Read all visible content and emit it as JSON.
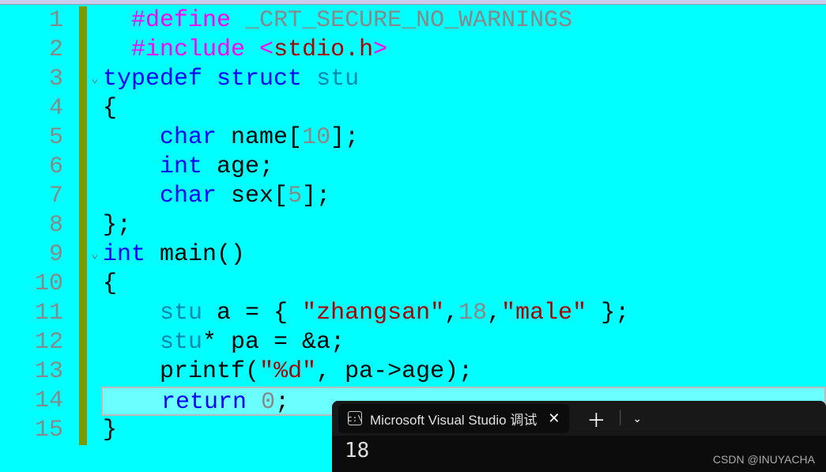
{
  "gutter": [
    "1",
    "2",
    "3",
    "4",
    "5",
    "6",
    "7",
    "8",
    "9",
    "10",
    "11",
    "12",
    "13",
    "14",
    "15"
  ],
  "code": {
    "l1": {
      "pp": "#define",
      "sp": " ",
      "macro": "_CRT_SECURE_NO_WARNINGS"
    },
    "l2": {
      "pp": "#include ",
      "open": "<",
      "hdr": "stdio.h",
      "close": ">"
    },
    "l3": {
      "kw1": "typedef",
      "sp": " ",
      "kw2": "struct",
      "sp2": " ",
      "name": "stu"
    },
    "l4": {
      "brace": "{"
    },
    "l5": {
      "indent": "    ",
      "type": "char",
      "sp": " ",
      "ident": "name",
      "br": "[",
      "num": "10",
      "end": "];"
    },
    "l6": {
      "indent": "    ",
      "type": "int",
      "sp": " ",
      "ident": "age",
      "end": ";"
    },
    "l7": {
      "indent": "    ",
      "type": "char",
      "sp": " ",
      "ident": "sex",
      "br": "[",
      "num": "5",
      "end": "];"
    },
    "l8": {
      "brace": "};"
    },
    "l9": {
      "type": "int",
      "sp": " ",
      "ident": "main",
      "paren": "()"
    },
    "l10": {
      "brace": "{"
    },
    "l11": {
      "indent": "    ",
      "type": "stu",
      "sp": " ",
      "ident": "a = { ",
      "str1": "\"zhangsan\"",
      "sep1": ",",
      "num": "18",
      "sep2": ",",
      "str2": "\"male\"",
      "end": " };"
    },
    "l12": {
      "indent": "    ",
      "type": "stu",
      "star": "* ",
      "ident": "pa = &a;"
    },
    "l13": {
      "indent": "    ",
      "fn": "printf",
      "open": "(",
      "str": "\"%d\"",
      "sep": ", ",
      "expr": "pa->age",
      "end": ");"
    },
    "l14": {
      "indent": "    ",
      "kw": "return",
      "sp": " ",
      "num": "0",
      "end": ";"
    },
    "l15": {
      "brace": "}"
    }
  },
  "terminal": {
    "tab_icon": "c:\\",
    "tab_title": "Microsoft Visual Studio 调试",
    "output": "18"
  },
  "watermark": "CSDN @INUYACHA"
}
